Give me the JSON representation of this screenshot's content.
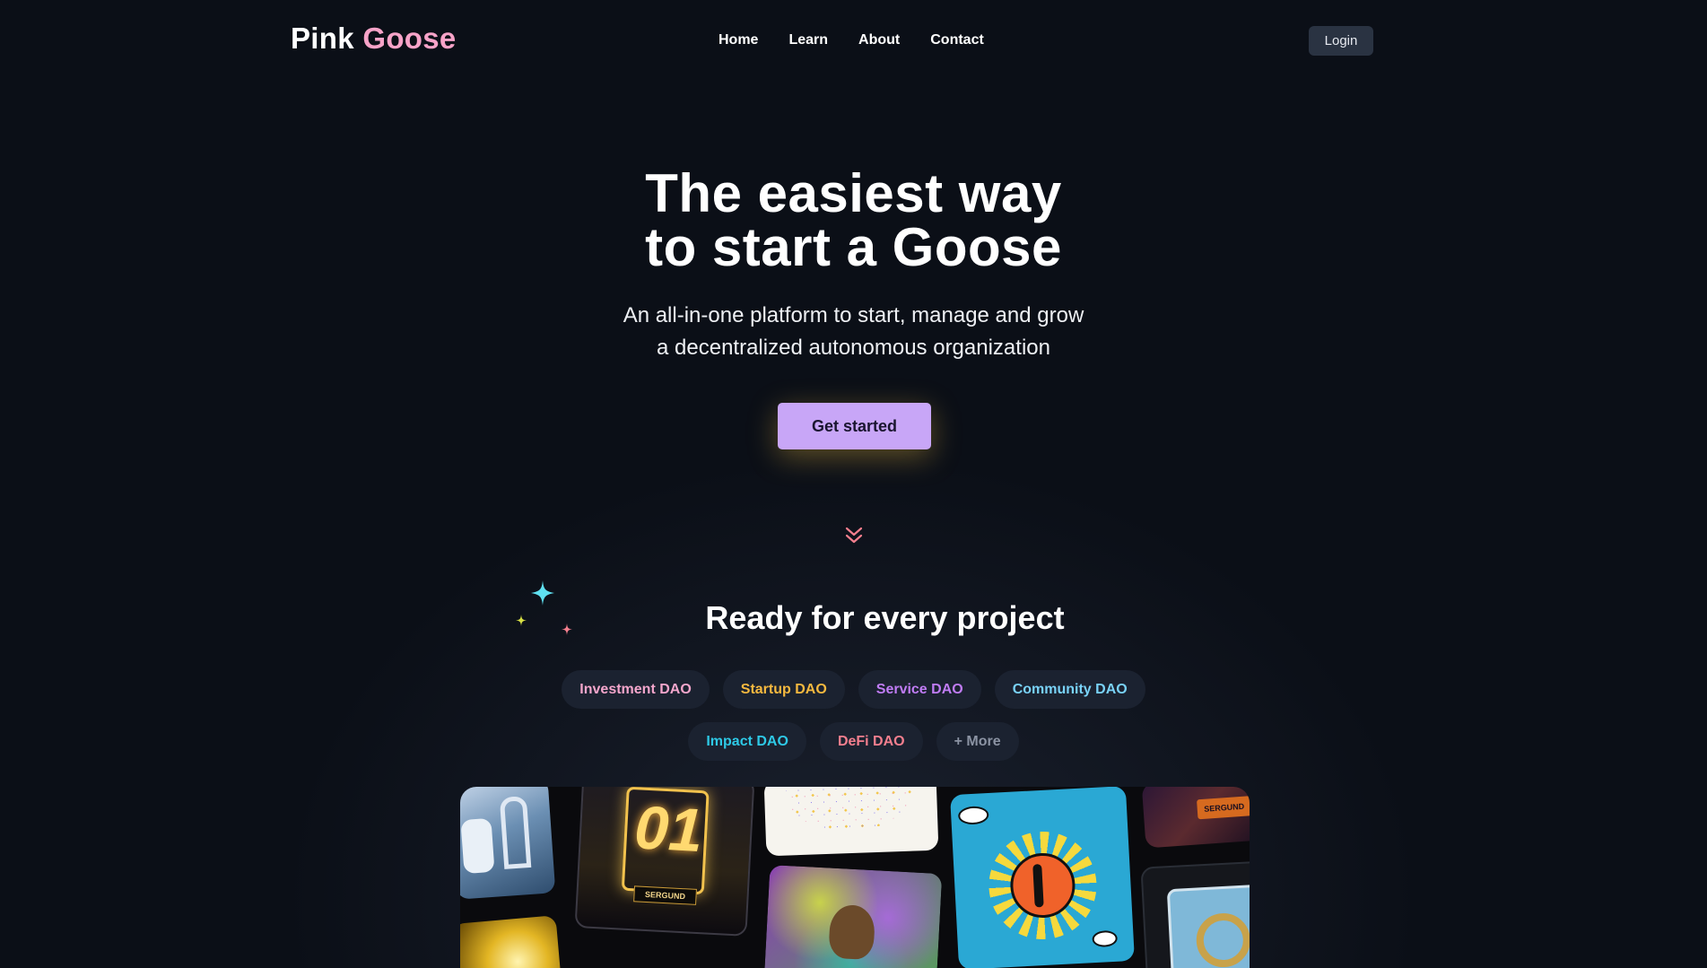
{
  "brand": {
    "name_part1": "Pink",
    "name_part2": "Goose"
  },
  "nav": {
    "items": [
      {
        "label": "Home"
      },
      {
        "label": "Learn"
      },
      {
        "label": "About"
      },
      {
        "label": "Contact"
      }
    ]
  },
  "header": {
    "login_label": "Login"
  },
  "hero": {
    "title_line1": "The easiest way",
    "title_line2": "to start a Goose",
    "subtitle_line1": "An all-in-one platform to start, manage and grow",
    "subtitle_line2": "a decentralized autonomous organization",
    "cta_label": "Get started"
  },
  "projects": {
    "title": "Ready for every project",
    "chips_row1": [
      {
        "label": "Investment DAO",
        "color": "#f4a6cc"
      },
      {
        "label": "Startup DAO",
        "color": "#f6b93f"
      },
      {
        "label": "Service DAO",
        "color": "#c07cf5"
      },
      {
        "label": "Community DAO",
        "color": "#79d2f7"
      }
    ],
    "chips_row2": [
      {
        "label": "Impact DAO",
        "color": "#2ec9e6"
      },
      {
        "label": "DeFi DAO",
        "color": "#f47f8e"
      },
      {
        "label": "+ More",
        "color": "#8b93a3"
      }
    ]
  },
  "gallery": {
    "tile_texts": [
      "01",
      "SERGUND",
      "SERGUND"
    ]
  },
  "colors": {
    "background": "#0b0f17",
    "brand_accent": "#f7a3c8",
    "cta": "#c8a6f7",
    "login_bg": "#2a3342",
    "chip_bg": "#1b2230",
    "chevron": "#f47f8e"
  },
  "icons": [
    "chevron-down-double-icon",
    "sparkle-icon"
  ]
}
